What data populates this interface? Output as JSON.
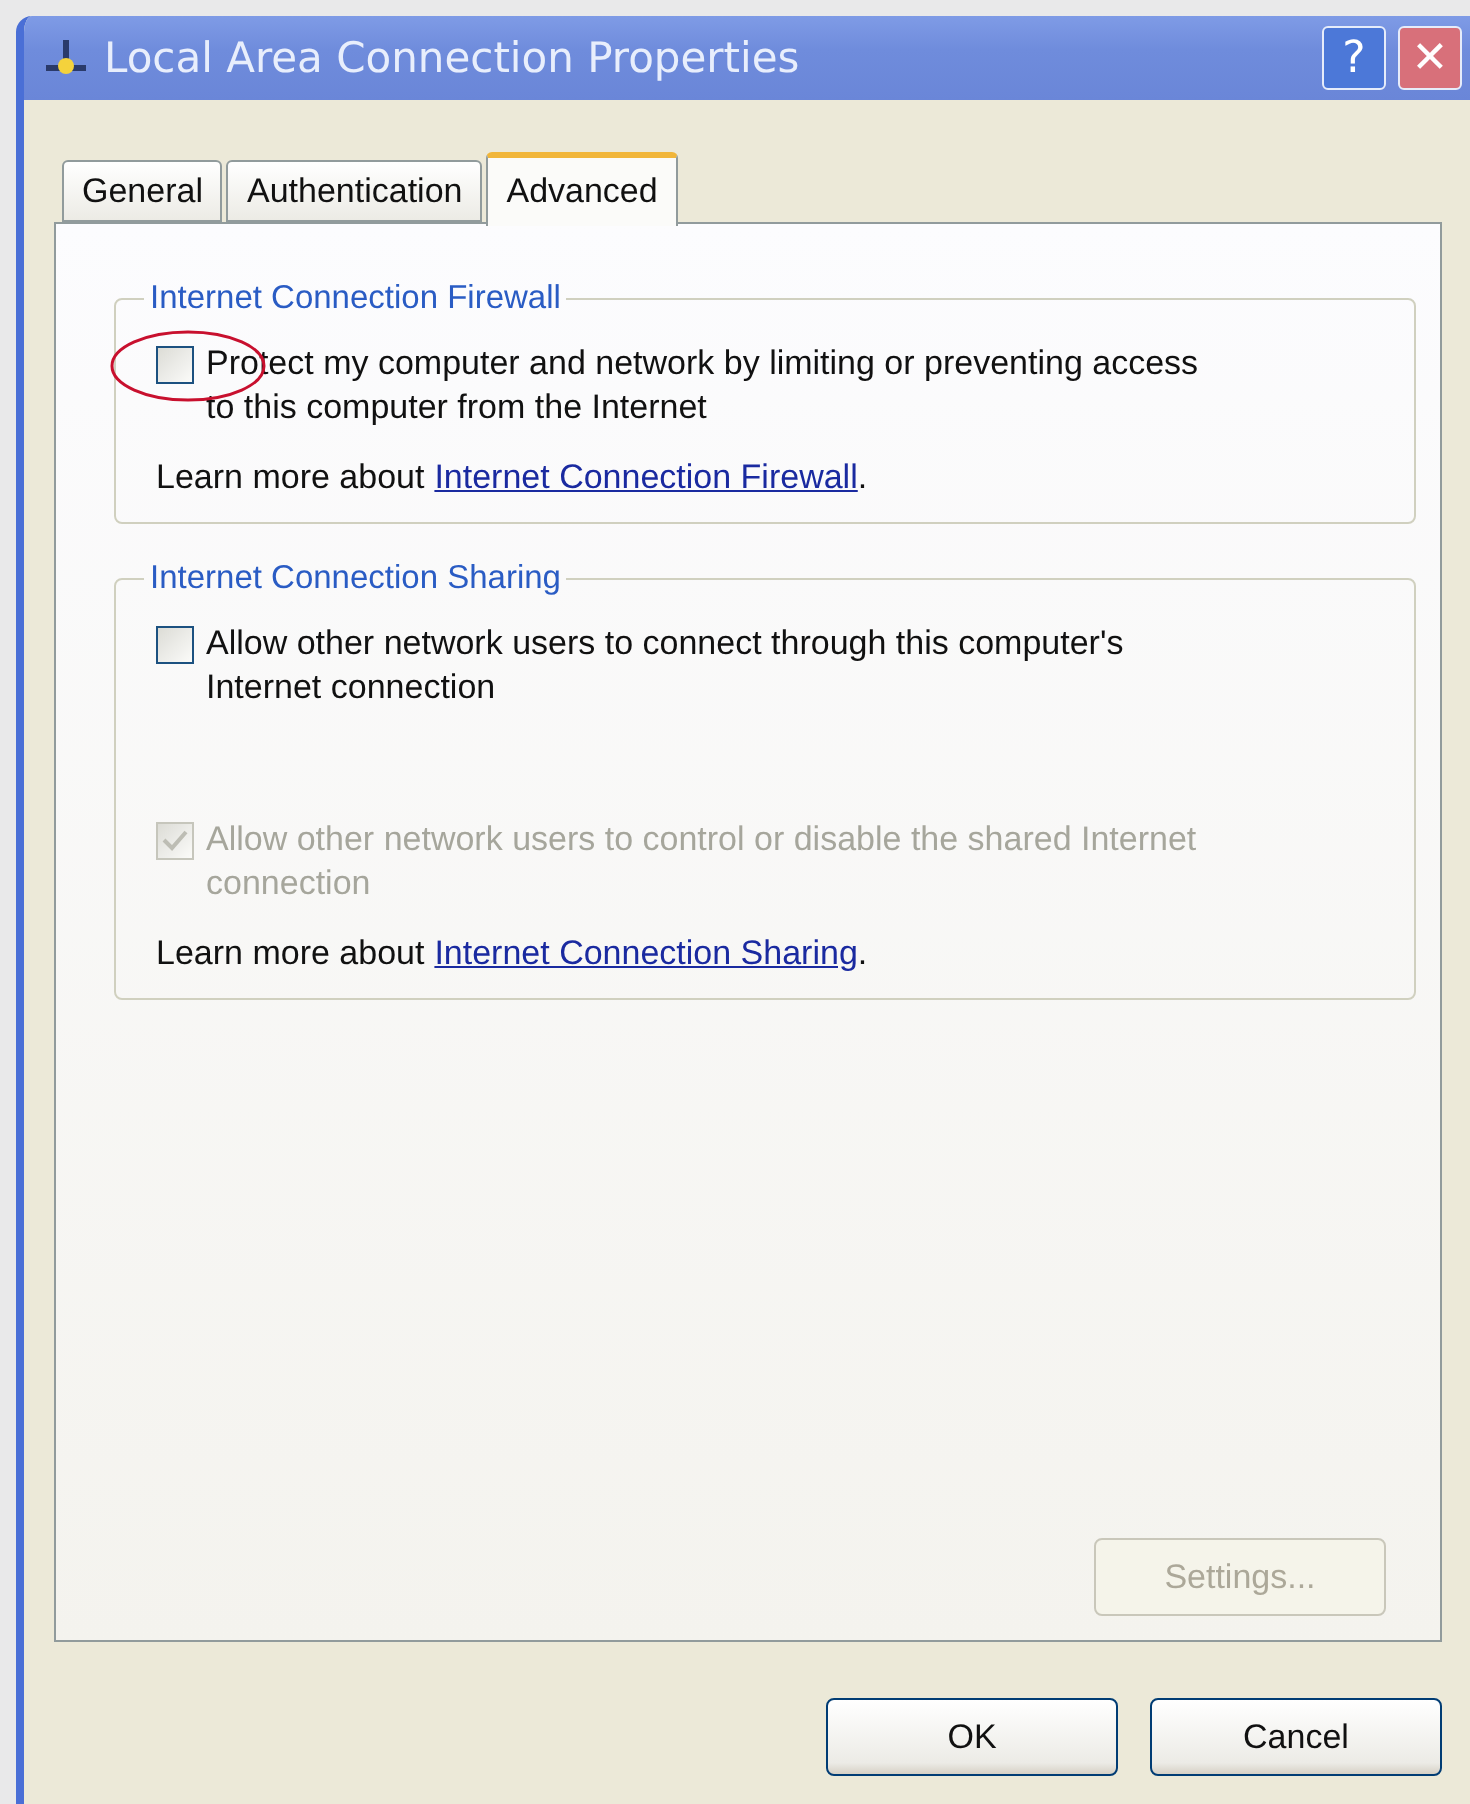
{
  "window": {
    "title": "Local Area Connection Properties",
    "buttons": [
      {
        "kind": "help",
        "label": "?"
      },
      {
        "kind": "close",
        "label": "✕"
      }
    ]
  },
  "tabs": [
    {
      "label": "General",
      "selected": false
    },
    {
      "label": "Authentication",
      "selected": false
    },
    {
      "label": "Advanced",
      "selected": true
    }
  ],
  "groups": [
    {
      "title": "Internet Connection Firewall",
      "options": [
        {
          "label": "Protect my computer and network by limiting or preventing access to this computer from the Internet",
          "checked": false,
          "disabled": false,
          "circled": true
        }
      ],
      "learn_more": {
        "text": "Learn more about",
        "link": "Internet Connection Firewall",
        "end": "."
      }
    },
    {
      "title": "Internet Connection Sharing",
      "options": [
        {
          "label": "Allow other network users to connect through this computer's Internet connection",
          "checked": false,
          "disabled": false,
          "circled": false
        },
        {
          "label": "Allow other network users to control or disable the shared Internet connection",
          "checked": true,
          "disabled": true,
          "circled": false
        }
      ],
      "learn_more": {
        "text": "Learn more about",
        "link": "Internet Connection Sharing",
        "end": "."
      }
    }
  ],
  "settings_button": {
    "label": "Settings...",
    "disabled": true
  },
  "buttons": [
    {
      "label": "OK"
    },
    {
      "label": "Cancel"
    }
  ]
}
